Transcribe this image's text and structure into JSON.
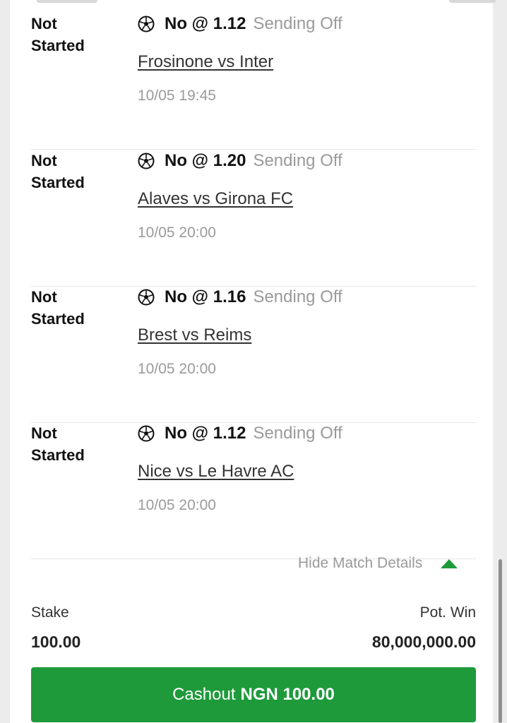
{
  "bets": [
    {
      "status": "Not\nStarted",
      "pick": "No @ 1.12",
      "market": "Sending Off",
      "match": "Frosinone vs Inter",
      "time": "10/05 19:45"
    },
    {
      "status": "Not\nStarted",
      "pick": "No @ 1.20",
      "market": "Sending Off",
      "match": "Alaves vs Girona FC",
      "time": "10/05 20:00"
    },
    {
      "status": "Not\nStarted",
      "pick": "No @ 1.16",
      "market": "Sending Off",
      "match": "Brest vs Reims",
      "time": "10/05 20:00"
    },
    {
      "status": "Not\nStarted",
      "pick": "No @ 1.12",
      "market": "Sending Off",
      "match": "Nice vs Le Havre AC",
      "time": "10/05 20:00"
    }
  ],
  "details_toggle": {
    "label": "Hide Match Details",
    "icon": "caret-up-icon"
  },
  "summary": {
    "stake_label": "Stake",
    "stake_value": "100.00",
    "pot_win_label": "Pot. Win",
    "pot_win_value": "80,000,000.00"
  },
  "cashout": {
    "label": "Cashout",
    "amount": "NGN 100.00"
  },
  "colors": {
    "accent": "#1e9a3b",
    "muted": "#9a9a9a",
    "text": "#111111"
  },
  "icons": {
    "sport": "soccer-ball-icon"
  }
}
